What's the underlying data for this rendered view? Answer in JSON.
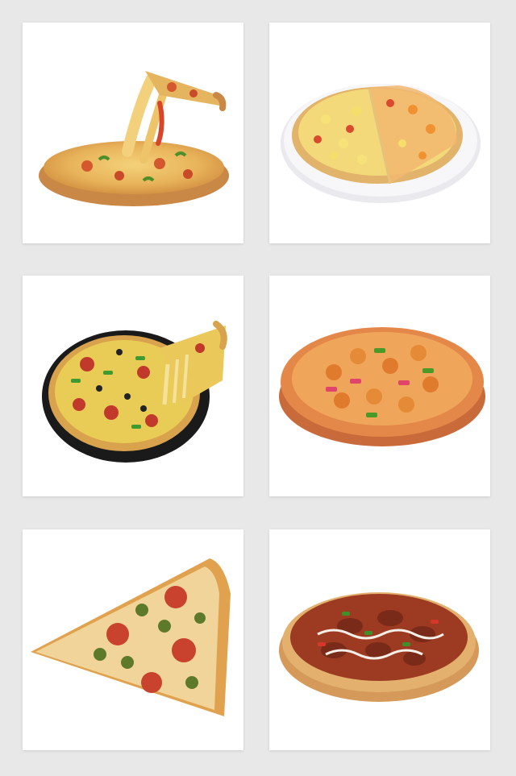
{
  "background_color": "#e8e8e8",
  "card_color": "#ffffff",
  "cards": [
    {
      "image": "pizza-with-cheese-pull-slice-icon"
    },
    {
      "image": "pineapple-pizza-on-plate-icon"
    },
    {
      "image": "supreme-pizza-in-black-pan-icon"
    },
    {
      "image": "chicken-nugget-pizza-icon"
    },
    {
      "image": "pepperoni-jalapeno-pizza-slice-icon"
    },
    {
      "image": "bbq-meat-pizza-icon"
    }
  ]
}
